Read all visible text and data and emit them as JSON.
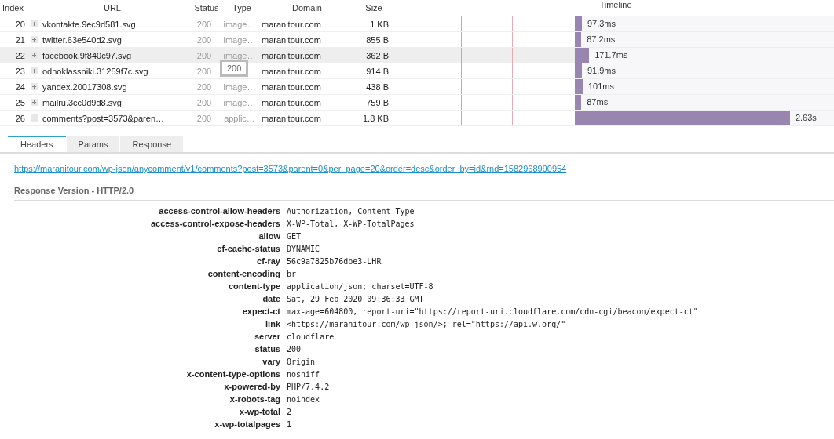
{
  "table": {
    "columns": [
      "Index",
      "URL",
      "Status",
      "Type",
      "Domain",
      "Size",
      "Timeline"
    ],
    "rows": [
      {
        "index": "20",
        "expanded": false,
        "url": "vkontakte.9ec9d581.svg",
        "status": "200",
        "type": "image…",
        "domain": "maranitour.com",
        "size": "1 KB",
        "level": 0.027,
        "time": "97.3ms",
        "selected": false
      },
      {
        "index": "21",
        "expanded": false,
        "url": "twitter.63e540d2.svg",
        "status": "200",
        "type": "image…",
        "domain": "maranitour.com",
        "size": "855 B",
        "level": 0.025,
        "time": "87.2ms",
        "selected": false
      },
      {
        "index": "22",
        "expanded": false,
        "url": "facebook.9f840c97.svg",
        "status": "200",
        "type": "image…",
        "domain": "maranitour.com",
        "size": "362 B",
        "level": 0.055,
        "time": "171.7ms",
        "selected": true
      },
      {
        "index": "23",
        "expanded": false,
        "url": "odnoklassniki.31259f7c.svg",
        "status": "200",
        "domain": "maranitour.com",
        "size": "914 B",
        "level": 0.027,
        "time": "91.9ms",
        "selected": false
      },
      {
        "index": "24",
        "expanded": false,
        "url": "yandex.20017308.svg",
        "status": "200",
        "type": "image…",
        "domain": "maranitour.com",
        "size": "438 B",
        "level": 0.03,
        "time": "101ms",
        "selected": false
      },
      {
        "index": "25",
        "expanded": false,
        "url": "mailru.3cc0d9d8.svg",
        "status": "200",
        "type": "image…",
        "domain": "maranitour.com",
        "size": "759 B",
        "level": 0.025,
        "time": "87ms",
        "selected": false
      },
      {
        "index": "26",
        "expanded": true,
        "url": "comments?post=3573&paren…",
        "status": "200",
        "type": "applic…",
        "domain": "maranitour.com",
        "size": "1.8 KB",
        "level": 0.83,
        "time": "2.63s",
        "selected": false
      }
    ],
    "tooltip": "200"
  },
  "tabs": [
    {
      "label": "Headers",
      "selected": true
    },
    {
      "label": "Params",
      "selected": false
    },
    {
      "label": "Response",
      "selected": false
    }
  ],
  "request_url": "https://maranitour.com/wp-json/anycomment/v1/comments?post=3573&parent=0&per_page=20&order=desc&order_by=id&rnd=1582968990954",
  "response_version": "Response Version - HTTP/2.0",
  "headers": [
    {
      "name": "access-control-allow-headers",
      "value": "Authorization, Content-Type"
    },
    {
      "name": "access-control-expose-headers",
      "value": "X-WP-Total, X-WP-TotalPages"
    },
    {
      "name": "allow",
      "value": "GET"
    },
    {
      "name": "cf-cache-status",
      "value": "DYNAMIC"
    },
    {
      "name": "cf-ray",
      "value": "56c9a7825b76dbe3-LHR"
    },
    {
      "name": "content-encoding",
      "value": "br"
    },
    {
      "name": "content-type",
      "value": "application/json; charset=UTF-8"
    },
    {
      "name": "date",
      "value": "Sat, 29 Feb 2020 09:36:33 GMT"
    },
    {
      "name": "expect-ct",
      "value": "max-age=604800, report-uri=\"https://report-uri.cloudflare.com/cdn-cgi/beacon/expect-ct\""
    },
    {
      "name": "link",
      "value": "<https://maranitour.com/wp-json/>; rel=\"https://api.w.org/\""
    },
    {
      "name": "server",
      "value": "cloudflare"
    },
    {
      "name": "status",
      "value": "200"
    },
    {
      "name": "vary",
      "value": "Origin"
    },
    {
      "name": "x-content-type-options",
      "value": "nosniff"
    },
    {
      "name": "x-powered-by",
      "value": "PHP/7.4.2"
    },
    {
      "name": "x-robots-tag",
      "value": "noindex"
    },
    {
      "name": "x-wp-total",
      "value": "2"
    },
    {
      "name": "x-wp-totalpages",
      "value": "1"
    }
  ]
}
